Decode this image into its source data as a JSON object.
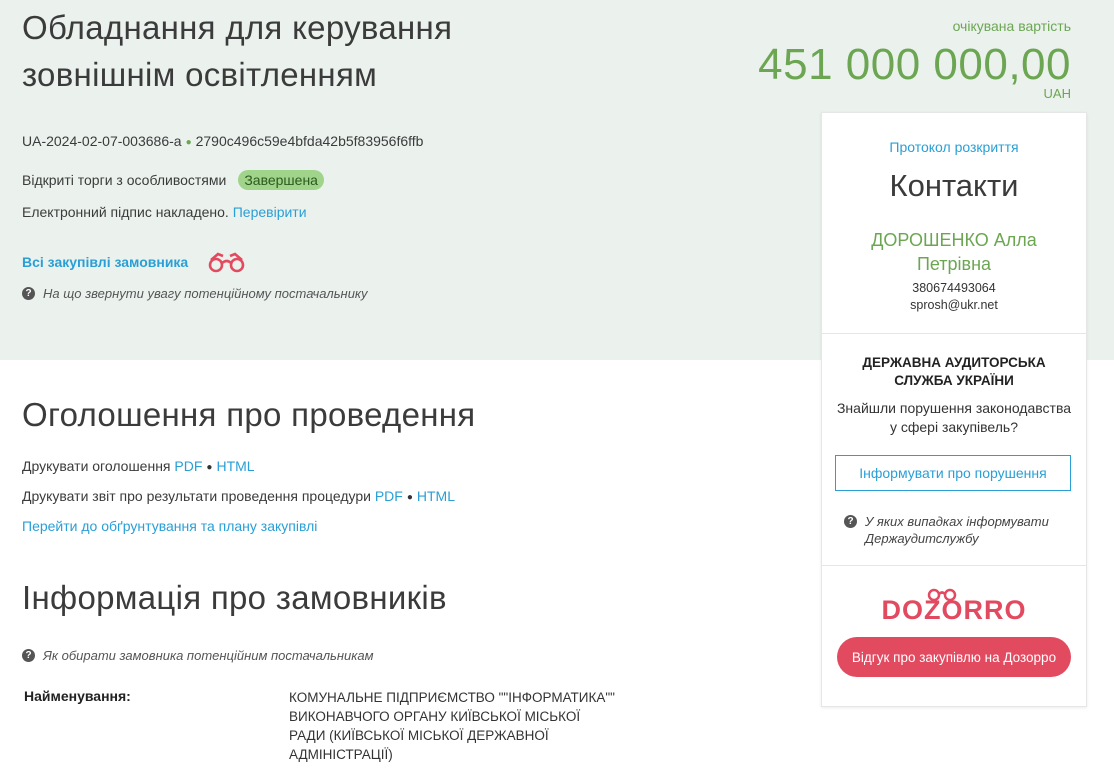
{
  "tender": {
    "title": "Обладнання для керування зовнішнім освітленням",
    "price_label": "очікувана вартість",
    "price_value": "451 000 000,00",
    "price_currency": "UAH",
    "tender_id": "UA-2024-02-07-003686-a",
    "hash": "2790c496c59e4bfda42b5f83956f6ffb",
    "procedure_type": "Відкриті торги з особливостями",
    "status": "Завершена",
    "signature_text": "Електронний підпис накладено.",
    "signature_link": "Перевірити",
    "all_purchases_link": "Всі закупівлі замовника",
    "supplier_hint": "На що звернути увагу потенційному постачальнику"
  },
  "announcement": {
    "heading": "Оголошення про проведення",
    "print_notice": "Друкувати оголошення",
    "print_report": "Друкувати звіт про результати проведення процедури",
    "pdf": "PDF",
    "html": "HTML",
    "plan_link": "Перейти до обґрунтування та плану закупівлі"
  },
  "customers": {
    "heading": "Інформація про замовників",
    "hint": "Як обирати замовника потенційним постачальникам",
    "name_label": "Найменування:",
    "name_value": "КОМУНАЛЬНЕ ПІДПРИЄМСТВО \"\"ІНФОРМАТИКА\"\" ВИКОНАВЧОГО ОРГАНУ КИЇВСЬКОЇ МІСЬКОЇ РАДИ (КИЇВСЬКОЇ МІСЬКОЇ ДЕРЖАВНОЇ АДМІНІСТРАЦІЇ)"
  },
  "sidebar": {
    "protocol_link": "Протокол розкриття",
    "contacts_heading": "Контакти",
    "person": "ДОРОШЕНКО Алла Петрівна",
    "phone": "380674493064",
    "email": "sprosh@ukr.net",
    "dasu_title": "ДЕРЖАВНА АУДИТОРСЬКА СЛУЖБА УКРАЇНИ",
    "dasu_text": "Знайшли порушення законодавства у сфері закупівель?",
    "report_button": "Інформувати про порушення",
    "dasu_hint": "У яких випадках інформувати Держаудитслужбу",
    "dozorro_logo_text": "DOZORRO",
    "dozorro_button": "Відгук про закупівлю на Дозорро"
  },
  "icons": {
    "binoculars": "binoculars-icon",
    "question": "question-circle-icon"
  },
  "colors": {
    "band_bg": "#ebf2ee",
    "green": "#6ca652",
    "link": "#2a9fd6",
    "dozorro": "#e24a60"
  }
}
